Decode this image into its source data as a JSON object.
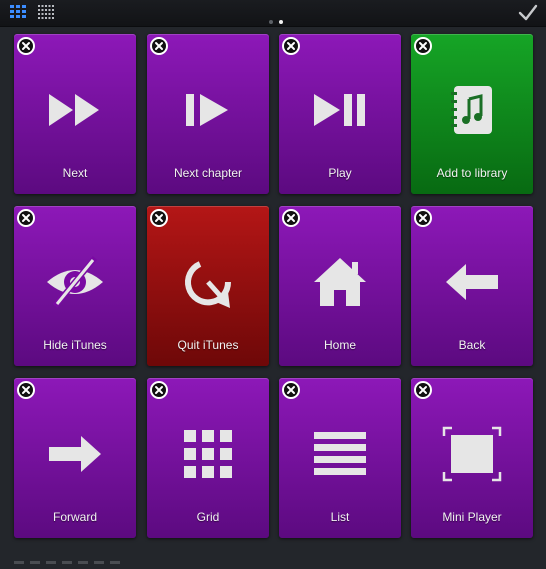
{
  "toolbar": {
    "large_view_icon": "large-grid-icon",
    "small_view_icon": "small-grid-icon",
    "done_icon": "checkmark-icon",
    "page_count": 2,
    "current_page": 2
  },
  "colors": {
    "purple": "#7a0aa3",
    "red": "#a10d0d",
    "green": "#0e8f1c"
  },
  "tiles": [
    {
      "label": "Next",
      "icon": "fast-forward-icon",
      "color": "purple"
    },
    {
      "label": "Next chapter",
      "icon": "next-chapter-icon",
      "color": "purple"
    },
    {
      "label": "Play",
      "icon": "play-pause-icon",
      "color": "purple"
    },
    {
      "label": "Add to library",
      "icon": "music-notebook-icon",
      "color": "green"
    },
    {
      "label": "Hide iTunes",
      "icon": "hidden-eye-icon",
      "color": "purple"
    },
    {
      "label": "Quit iTunes",
      "icon": "quit-icon",
      "color": "red"
    },
    {
      "label": "Home",
      "icon": "house-icon",
      "color": "purple"
    },
    {
      "label": "Back",
      "icon": "arrow-left-icon",
      "color": "purple"
    },
    {
      "label": "Forward",
      "icon": "arrow-right-icon",
      "color": "purple"
    },
    {
      "label": "Grid",
      "icon": "grid-icon",
      "color": "purple"
    },
    {
      "label": "List",
      "icon": "list-icon",
      "color": "purple"
    },
    {
      "label": "Mini Player",
      "icon": "mini-player-icon",
      "color": "purple"
    }
  ]
}
